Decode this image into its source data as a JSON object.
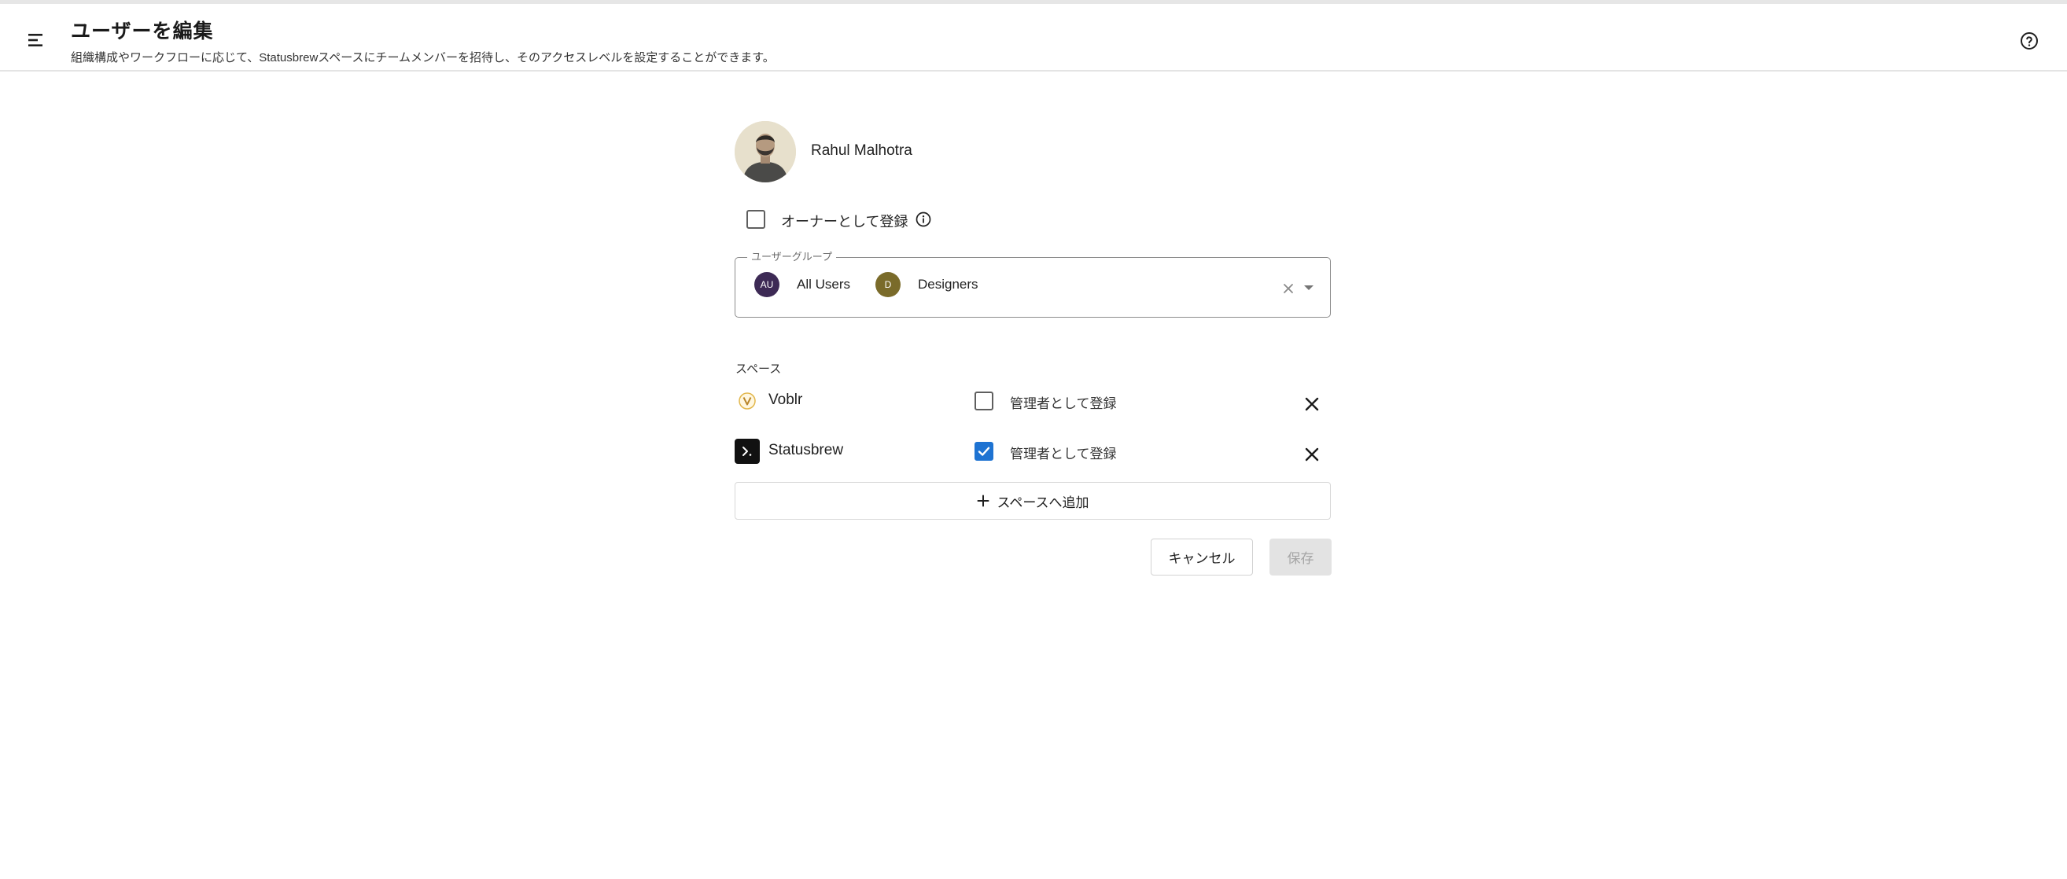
{
  "header": {
    "title": "ユーザーを編集",
    "subtitle": "組織構成やワークフローに応じて、Statusbrewスペースにチームメンバーを招待し、そのアクセスレベルを設定することができます。",
    "menu_icon": "menu-icon",
    "help_icon": "help-circle-icon"
  },
  "user": {
    "name": "Rahul Malhotra",
    "owner_label": "オーナーとして登録",
    "owner_checked": false,
    "owner_info_icon": "info-icon"
  },
  "user_groups": {
    "label": "ユーザーグループ",
    "chips": [
      {
        "badge": "AU",
        "label": "All Users",
        "color": "#3d2a55"
      },
      {
        "badge": "D",
        "label": "Designers",
        "color": "#7a6b2a"
      }
    ],
    "clear_icon": "close-icon",
    "dropdown_icon": "caret-down-icon"
  },
  "spaces": {
    "title": "スペース",
    "items": [
      {
        "name": "Voblr",
        "icon": "voblr-logo-icon",
        "admin_label": "管理者として登録",
        "admin_checked": false
      },
      {
        "name": "Statusbrew",
        "icon": "statusbrew-logo-icon",
        "admin_label": "管理者として登録",
        "admin_checked": true
      }
    ],
    "add_label": "スペースへ追加",
    "add_icon": "plus-icon"
  },
  "actions": {
    "cancel_label": "キャンセル",
    "save_label": "保存"
  },
  "colors": {
    "accent": "#1e73d2",
    "border": "#8c8c8c"
  }
}
